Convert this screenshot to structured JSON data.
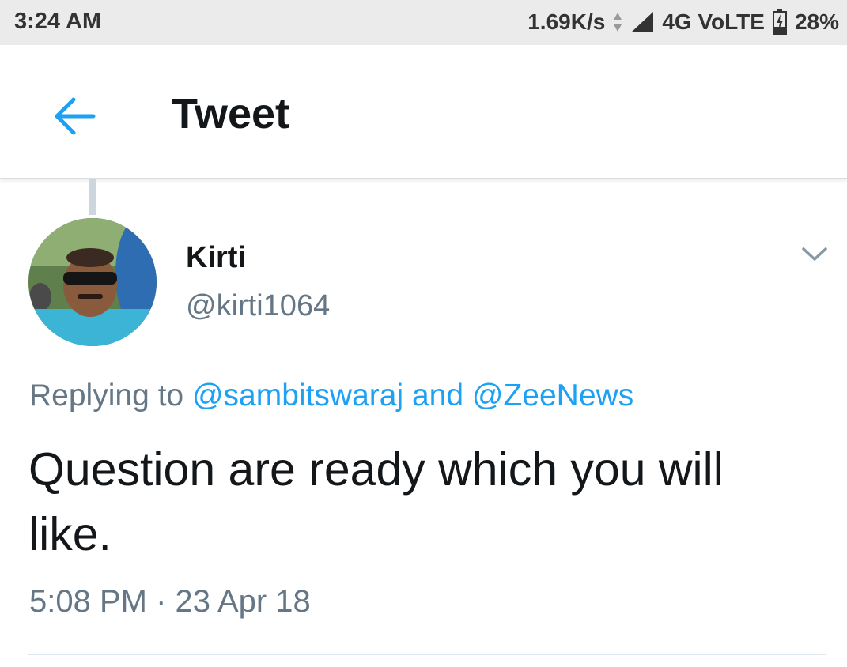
{
  "status_bar": {
    "time": "3:24 AM",
    "net_speed": "1.69K/s",
    "network": "4G VoLTE",
    "battery": "28%"
  },
  "app_bar": {
    "back_icon": "arrow-left-icon",
    "title": "Tweet"
  },
  "tweet": {
    "author_name": "Kirti",
    "author_handle": "@kirti1064",
    "more_icon": "chevron-down-icon",
    "replying_prefix": "Replying to",
    "reply_mention_1": "@sambitswaraj",
    "reply_joiner": "and",
    "reply_mention_2": "@ZeeNews",
    "text": "Question are ready which you will like.",
    "time": "5:08 PM",
    "separator": "·",
    "date": "23 Apr 18"
  },
  "colors": {
    "accent": "#1da1f2",
    "muted_text": "#657786",
    "primary_text": "#14171a",
    "status_bar_bg": "#ebebeb"
  }
}
